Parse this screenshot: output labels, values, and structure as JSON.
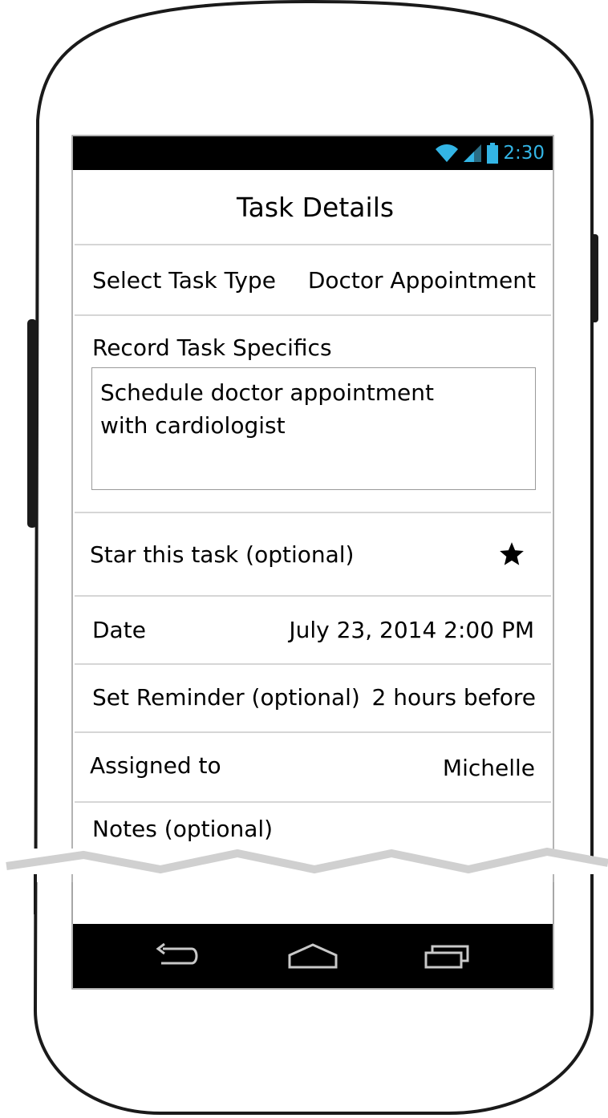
{
  "status_bar": {
    "time": "2:30",
    "icons": [
      "wifi-icon",
      "cell-signal-icon",
      "battery-icon"
    ],
    "accent_color": "#33b5e5"
  },
  "header": {
    "title": "Task Details"
  },
  "task_type": {
    "label": "Select Task Type",
    "value": "Doctor Appointment"
  },
  "specifics": {
    "label": "Record Task Specifics",
    "text": "Schedule doctor appointment\nwith cardiologist"
  },
  "star": {
    "label": "Star this task (optional)",
    "icon": "star-icon",
    "starred": true
  },
  "date": {
    "label": "Date",
    "value": "July 23, 2014 2:00 PM"
  },
  "reminder": {
    "label": "Set Reminder (optional)",
    "value": "2 hours before"
  },
  "assigned": {
    "label": "Assigned to",
    "value": "Michelle"
  },
  "notes": {
    "label": "Notes (optional)"
  },
  "nav_bar": {
    "icons": [
      "back-icon",
      "home-icon",
      "recent-apps-icon"
    ]
  }
}
